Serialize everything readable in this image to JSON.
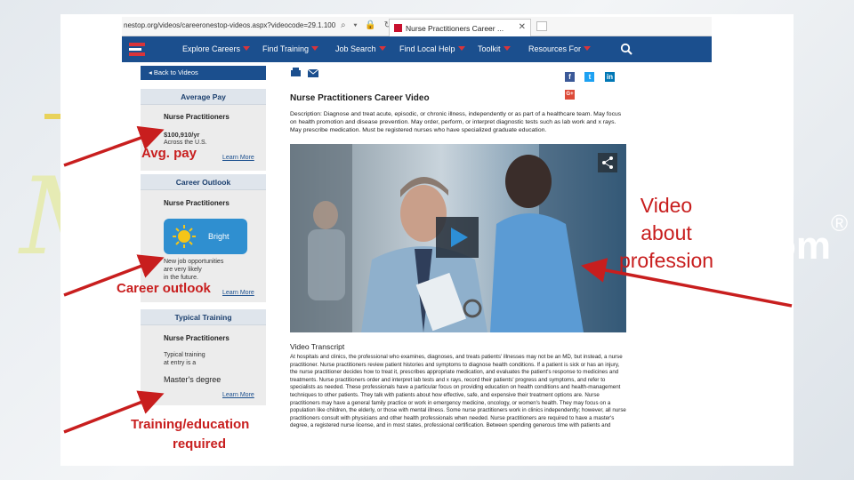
{
  "browser": {
    "url": "nestop.org/videos/careeronestop-videos.aspx?videocode=29.1.100",
    "tab_title": "Nurse Practitioners Career ...",
    "tab_close": "✕"
  },
  "nav": {
    "items": [
      {
        "label": "Explore Careers"
      },
      {
        "label": "Find Training"
      },
      {
        "label": "Job Search"
      },
      {
        "label": "Find Local Help"
      },
      {
        "label": "Toolkit"
      },
      {
        "label": "Resources For"
      }
    ]
  },
  "sidebar": {
    "back_label": "◂  Back to Videos",
    "average_pay": {
      "title": "Average Pay",
      "occupation": "Nurse Practitioners",
      "amount": "$100,910/yr",
      "scope": "Across the U.S.",
      "learn_more": "Learn More"
    },
    "career_outlook": {
      "title": "Career Outlook",
      "occupation": "Nurse Practitioners",
      "badge": "Bright",
      "line1": "New job opportunities",
      "line2": "are very likely",
      "line3": "in the future.",
      "learn_more": "Learn More"
    },
    "typical_training": {
      "title": "Typical Training",
      "occupation": "Nurse Practitioners",
      "line1": "Typical training",
      "line2": "at entry is a",
      "degree": "Master's degree",
      "learn_more": "Learn More"
    }
  },
  "main": {
    "title": "Nurse Practitioners Career Video",
    "description": "Description: Diagnose and treat acute, episodic, or chronic illness, independently or as part of a healthcare team. May focus on health promotion and disease prevention. May order, perform, or interpret diagnostic tests such as lab work and x rays. May prescribe medication. Must be registered nurses who have specialized graduate education.",
    "transcript_title": "Video Transcript",
    "transcript": "At hospitals and clinics, the professional who examines, diagnoses, and treats patients' illnesses may not be an MD, but instead, a nurse practitioner. Nurse practitioners review patient histories and symptoms to diagnose health conditions. If a patient is sick or has an injury, the nurse practitioner decides how to treat it, prescribes appropriate medication, and evaluates the patient's response to medicines and treatments. Nurse practitioners order and interpret lab tests and x rays, record their patients' progress and symptoms, and refer to specialists as needed. These professionals have a particular focus on providing education on health conditions and health-management techniques to other patients. They talk with patients about how effective, safe, and expensive their treatment options are. Nurse practitioners may have a general family practice or work in emergency medicine, oncology, or women's health. They may focus on a population like children, the elderly, or those with mental illness. Some nurse practitioners work in clinics independently; however, all nurse practitioners consult with physicians and other health professionals when needed. Nurse practitioners are required to have a master's degree, a registered nurse license, and in most states, professional certification. Between spending generous time with patients and"
  },
  "annotations": {
    "avg_pay": "Avg. pay",
    "career_outlook": "Career outlook",
    "training_line1": "Training/education",
    "training_line2": "required",
    "video_line1": "Video",
    "video_line2": "about",
    "video_line3": "profession"
  },
  "background": {
    "trademark": "®",
    "fragment": "om"
  },
  "colors": {
    "nav_blue": "#1b4f8e",
    "annotation_red": "#c81e1e",
    "caret_red": "#d9343a",
    "bright_blue": "#2f8fd0"
  }
}
